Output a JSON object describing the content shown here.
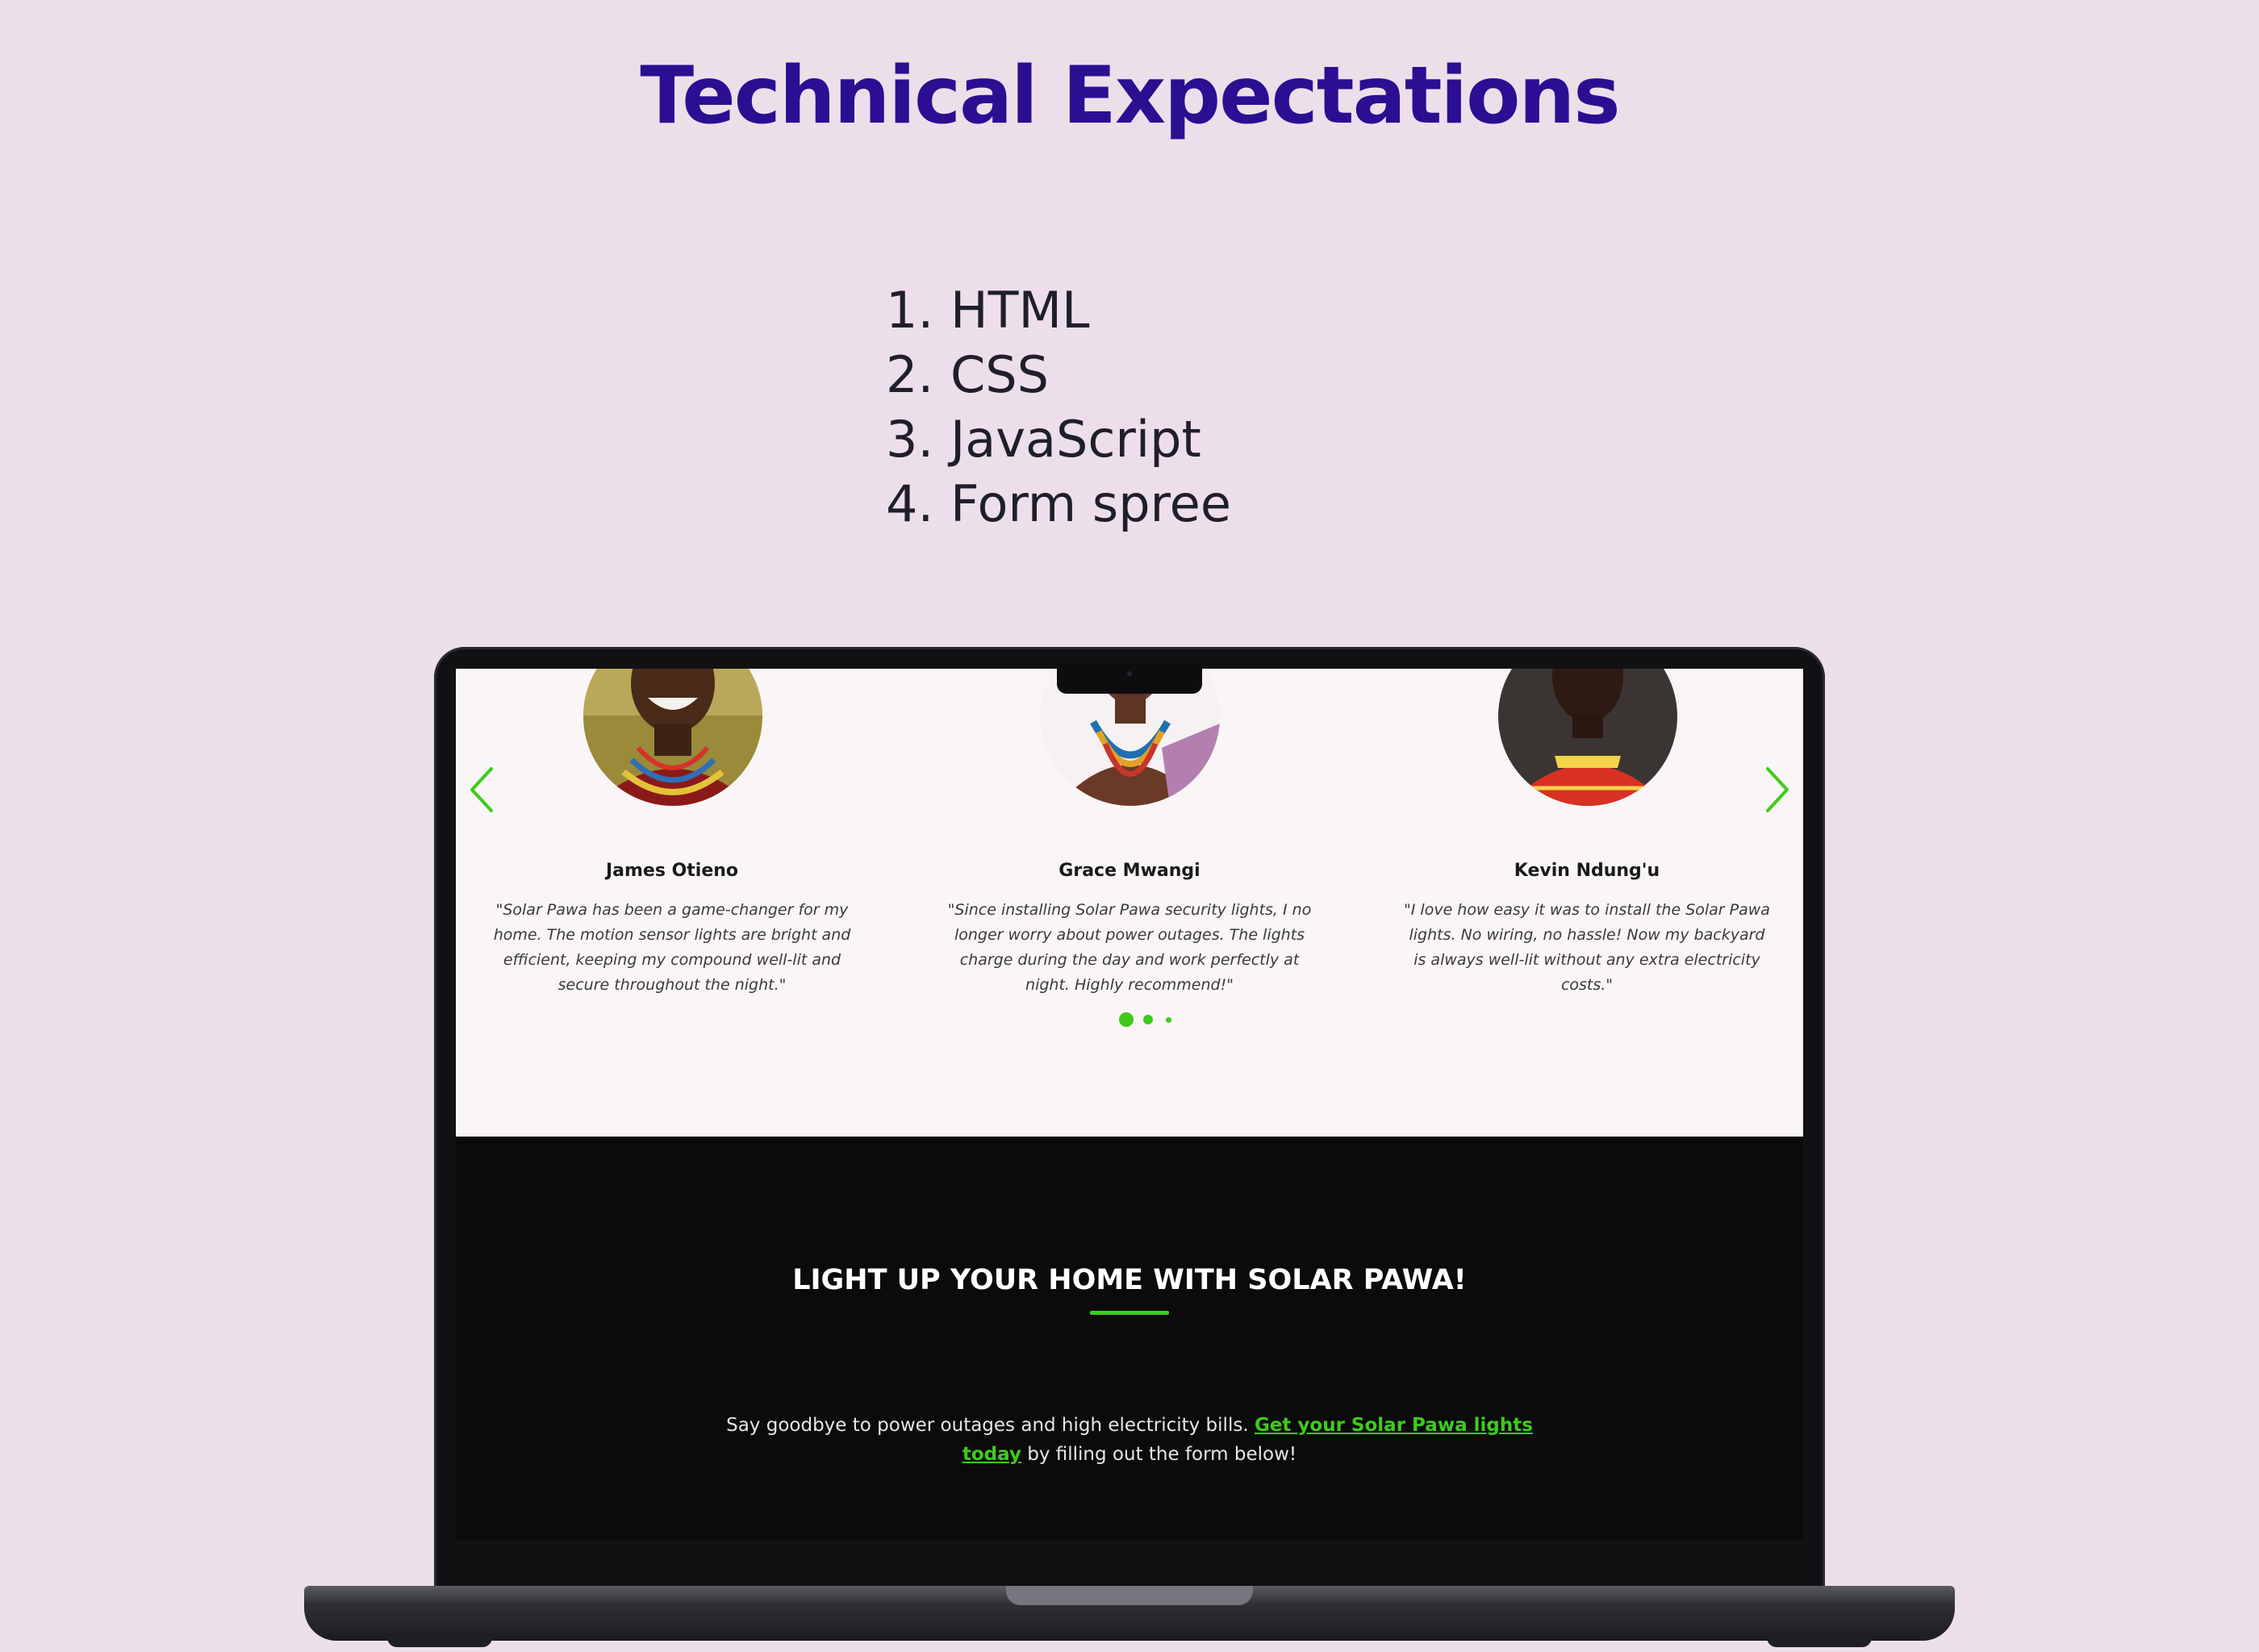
{
  "slide": {
    "title": "Technical Expectations",
    "list": [
      {
        "num": "1.",
        "text": "HTML"
      },
      {
        "num": "2.",
        "text": "CSS"
      },
      {
        "num": "3.",
        "text": "JavaScript"
      },
      {
        "num": "4.",
        "text": "Form spree"
      }
    ]
  },
  "testimonials": [
    {
      "name": "James Otieno",
      "quote": "\"Solar Pawa has been a game-changer for my home. The motion sensor lights are bright and efficient, keeping my compound well-lit and secure throughout the night.\""
    },
    {
      "name": "Grace Mwangi",
      "quote": "\"Since installing Solar Pawa security lights, I no longer worry about power outages. The lights charge during the day and work perfectly at night. Highly recommend!\""
    },
    {
      "name": "Kevin Ndung'u",
      "quote": "\"I love how easy it was to install the Solar Pawa lights. No wiring, no hassle! Now my backyard is always well-lit without any extra electricity costs.\""
    }
  ],
  "carousel": {
    "prev_icon": "chevron-left-icon",
    "next_icon": "chevron-right-icon",
    "dot_count": 3,
    "active_dot": 1
  },
  "cta": {
    "title": "LIGHT UP YOUR HOME WITH SOLAR PAWA!",
    "text_before": "Say goodbye to power outages and high electricity bills. ",
    "link_text": "Get your Solar Pawa lights today",
    "text_after": " by filling out the form below!"
  },
  "colors": {
    "background": "#eddfe9",
    "title": "#2a0f93",
    "accent_green": "#3ecb1c",
    "testimonial_bg": "#faf5f6",
    "cta_bg": "#0b0b0b"
  }
}
